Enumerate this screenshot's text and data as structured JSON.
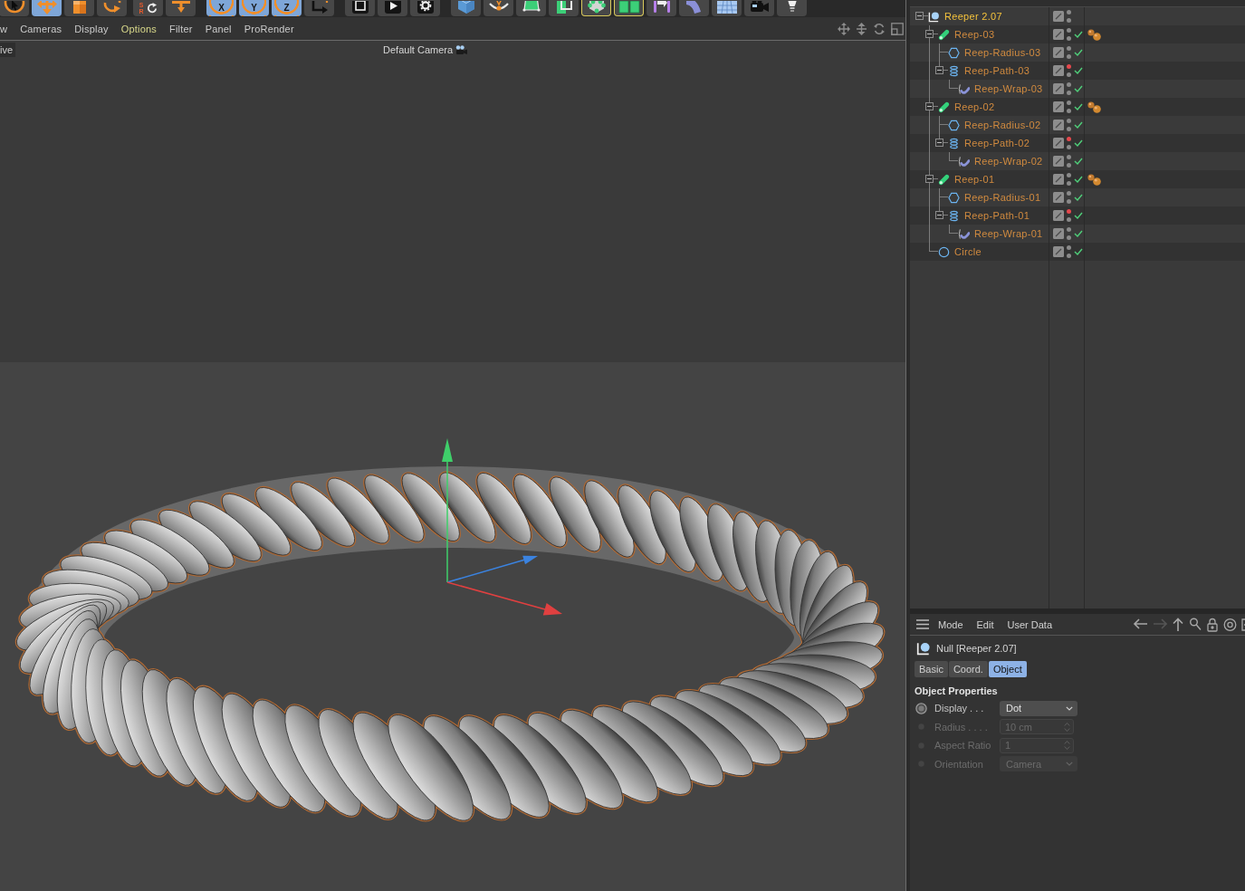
{
  "toolbar": [
    {
      "items": [
        {
          "kind": "live-selection",
          "selected": false,
          "outlined": false
        },
        {
          "kind": "move",
          "selected": true,
          "outlined": false
        },
        {
          "kind": "scale",
          "selected": false,
          "outlined": false
        },
        {
          "kind": "rotate",
          "selected": false,
          "outlined": false
        }
      ]
    },
    {
      "items": [
        {
          "kind": "coordinate-mode",
          "label": "S R",
          "selected": false,
          "outlined": false
        },
        {
          "kind": "transform",
          "selected": false,
          "outlined": false
        }
      ]
    },
    {
      "items": [
        {
          "kind": "axis",
          "label": "X",
          "selected": true,
          "outlined": false
        },
        {
          "kind": "axis",
          "label": "Y",
          "selected": true,
          "outlined": false
        },
        {
          "kind": "axis",
          "label": "Z",
          "selected": true,
          "outlined": false
        },
        {
          "kind": "coordinate-system",
          "selected": false,
          "outlined": false
        }
      ]
    },
    {
      "items": [
        {
          "kind": "render-view",
          "selected": false,
          "outlined": false
        },
        {
          "kind": "render",
          "selected": false,
          "outlined": false
        },
        {
          "kind": "render-settings",
          "selected": false,
          "outlined": false
        }
      ]
    },
    {
      "items": [
        {
          "kind": "cube",
          "selected": false,
          "outlined": false
        },
        {
          "kind": "pen",
          "selected": false,
          "outlined": false
        },
        {
          "kind": "subdivision",
          "selected": false,
          "outlined": false
        },
        {
          "kind": "extrude",
          "selected": false,
          "outlined": false
        },
        {
          "kind": "cloner",
          "selected": false,
          "outlined": true
        },
        {
          "kind": "fracture",
          "selected": false,
          "outlined": true
        },
        {
          "kind": "deformer",
          "selected": false,
          "outlined": false
        },
        {
          "kind": "bend",
          "selected": false,
          "outlined": false
        },
        {
          "kind": "floor",
          "selected": false,
          "outlined": false
        },
        {
          "kind": "camera",
          "selected": false,
          "outlined": false
        },
        {
          "kind": "light",
          "selected": false,
          "outlined": false
        }
      ]
    }
  ],
  "viewport_menu": [
    {
      "label": "w",
      "selected": false
    },
    {
      "label": "Cameras",
      "selected": false
    },
    {
      "label": "Display",
      "selected": false
    },
    {
      "label": "Options",
      "selected": true
    },
    {
      "label": "Filter",
      "selected": false
    },
    {
      "label": "Panel",
      "selected": false
    },
    {
      "label": "ProRender",
      "selected": false
    }
  ],
  "viewport": {
    "view_name": "ive",
    "camera": "Default Camera"
  },
  "objects": [
    {
      "name": "Reeper 2.07",
      "kind": "null",
      "selected": true,
      "active": true,
      "expanded": true,
      "editor_off": false,
      "enabled": false,
      "children": [
        {
          "name": "Reep-03",
          "kind": "sweep",
          "selected": true,
          "active": false,
          "expanded": true,
          "editor_off": false,
          "enabled": true,
          "tags": [
            {
              "kind": "spheres"
            }
          ],
          "children": [
            {
              "name": "Reep-Radius-03",
              "kind": "polygon",
              "selected": true,
              "active": false,
              "editor_off": false,
              "enabled": true
            },
            {
              "name": "Reep-Path-03",
              "kind": "helix",
              "selected": true,
              "active": false,
              "expanded": true,
              "editor_off": true,
              "enabled": true,
              "children": [
                {
                  "name": "Reep-Wrap-03",
                  "kind": "wrap",
                  "selected": true,
                  "active": false,
                  "editor_off": false,
                  "enabled": true
                }
              ]
            }
          ]
        },
        {
          "name": "Reep-02",
          "kind": "sweep",
          "selected": true,
          "active": false,
          "expanded": true,
          "editor_off": false,
          "enabled": true,
          "tags": [
            {
              "kind": "spheres"
            }
          ],
          "children": [
            {
              "name": "Reep-Radius-02",
              "kind": "polygon",
              "selected": true,
              "active": false,
              "editor_off": false,
              "enabled": true
            },
            {
              "name": "Reep-Path-02",
              "kind": "helix",
              "selected": true,
              "active": false,
              "expanded": true,
              "editor_off": true,
              "enabled": true,
              "children": [
                {
                  "name": "Reep-Wrap-02",
                  "kind": "wrap",
                  "selected": true,
                  "active": false,
                  "editor_off": false,
                  "enabled": true
                }
              ]
            }
          ]
        },
        {
          "name": "Reep-01",
          "kind": "sweep",
          "selected": true,
          "active": false,
          "expanded": true,
          "editor_off": false,
          "enabled": true,
          "tags": [
            {
              "kind": "spheres"
            }
          ],
          "children": [
            {
              "name": "Reep-Radius-01",
              "kind": "polygon",
              "selected": true,
              "active": false,
              "editor_off": false,
              "enabled": true
            },
            {
              "name": "Reep-Path-01",
              "kind": "helix",
              "selected": true,
              "active": false,
              "expanded": true,
              "editor_off": true,
              "enabled": true,
              "children": [
                {
                  "name": "Reep-Wrap-01",
                  "kind": "wrap",
                  "selected": true,
                  "active": false,
                  "editor_off": false,
                  "enabled": true
                }
              ]
            }
          ]
        },
        {
          "name": "Circle",
          "kind": "circle",
          "selected": true,
          "active": false,
          "editor_off": false,
          "enabled": true
        }
      ]
    }
  ],
  "attributes": {
    "menu": [
      "Mode",
      "Edit",
      "User Data"
    ],
    "nav": [
      {
        "kind": "back",
        "disabled": false
      },
      {
        "kind": "forward",
        "disabled": true
      },
      {
        "kind": "up",
        "disabled": false
      },
      {
        "kind": "search",
        "disabled": false
      },
      {
        "kind": "lock",
        "disabled": false
      },
      {
        "kind": "target",
        "disabled": false
      },
      {
        "kind": "panel",
        "disabled": false
      }
    ],
    "title": "Null [Reeper 2.07]",
    "tabs": [
      {
        "label": "Basic",
        "selected": false
      },
      {
        "label": "Coord.",
        "selected": false
      },
      {
        "label": "Object",
        "selected": true
      }
    ],
    "section": "Object Properties",
    "properties": [
      {
        "label": "Display . . .",
        "kind": "dropdown",
        "value": "Dot",
        "disabled": false
      },
      {
        "label": "Radius . . . .",
        "kind": "number",
        "value": "10 cm",
        "disabled": true
      },
      {
        "label": "Aspect Ratio",
        "kind": "number",
        "value": "1",
        "disabled": true
      },
      {
        "label": "Orientation",
        "kind": "dropdown",
        "value": "Camera",
        "disabled": true
      }
    ]
  }
}
